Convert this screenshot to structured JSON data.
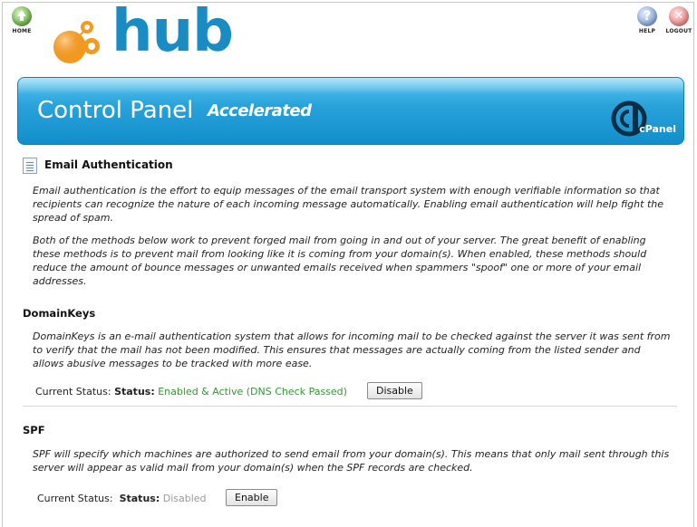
{
  "nav": {
    "home_label": "HOME",
    "help_label": "HELP",
    "logout_label": "LOGOUT",
    "help_glyph": "?",
    "logout_glyph": "✕"
  },
  "logo": {
    "text": "hub",
    "color": "#1a8cc4",
    "accent": "#f39a1f"
  },
  "banner": {
    "title": "Control Panel",
    "subtitle": "Accelerated",
    "brand": "cPanel",
    "color": "#1e9ad6"
  },
  "page": {
    "title": "Email Authentication",
    "intro": [
      "Email authentication is the effort to equip messages of the email transport system with enough verifiable information so that recipients can recognize the nature of each incoming message automatically. Enabling email authentication will help fight the spread of spam.",
      "Both of the methods below work to prevent forged mail from going in and out of your server. The great benefit of enabling these methods is to prevent mail from looking like it is coming from your domain(s). When enabled, these methods should reduce the amount of bounce messages or unwanted emails received when spammers \"spoof\" one or more of your email addresses."
    ]
  },
  "domainkeys": {
    "heading": "DomainKeys",
    "description": "DomainKeys is an e-mail authentication system that allows for incoming mail to be checked against the server it was sent from to verify that the mail has not been modified. This ensures that messages are actually coming from the listed sender and allows abusive messages to be tracked with more ease.",
    "current_status_label": "Current Status:",
    "status_label": "Status:",
    "status_value": "Enabled & Active (DNS Check Passed)",
    "status_color": "#2f9a2f",
    "button_label": "Disable"
  },
  "spf": {
    "heading": "SPF",
    "description": "SPF will specify which machines are authorized to send email from your domain(s). This means that only mail sent through this server will appear as valid mail from your domain(s) when the SPF records are checked.",
    "current_status_label": "Current Status:",
    "status_label": "Status:",
    "status_value": "Disabled",
    "status_color": "#9a9a9a",
    "button_label": "Enable"
  }
}
